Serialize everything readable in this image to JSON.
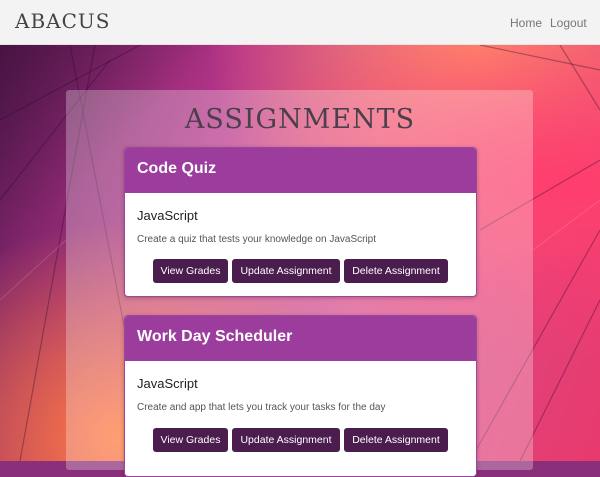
{
  "nav": {
    "brand": "ABACUS",
    "links": [
      "Home",
      "Logout"
    ]
  },
  "page": {
    "title": "ASSIGNMENTS"
  },
  "assignments": [
    {
      "title": "Code Quiz",
      "language": "JavaScript",
      "description": "Create a quiz that tests your knowledge on JavaScript",
      "buttons": [
        "View Grades",
        "Update Assignment",
        "Delete Assignment"
      ]
    },
    {
      "title": "Work Day Scheduler",
      "language": "JavaScript",
      "description": "Create and app that lets you track your tasks for the day",
      "buttons": [
        "View Grades",
        "Update Assignment",
        "Delete Assignment"
      ]
    }
  ],
  "colors": {
    "card_header": "#9c3d9e",
    "button": "#4b1c4e",
    "navbar": "#f3f3f3"
  }
}
